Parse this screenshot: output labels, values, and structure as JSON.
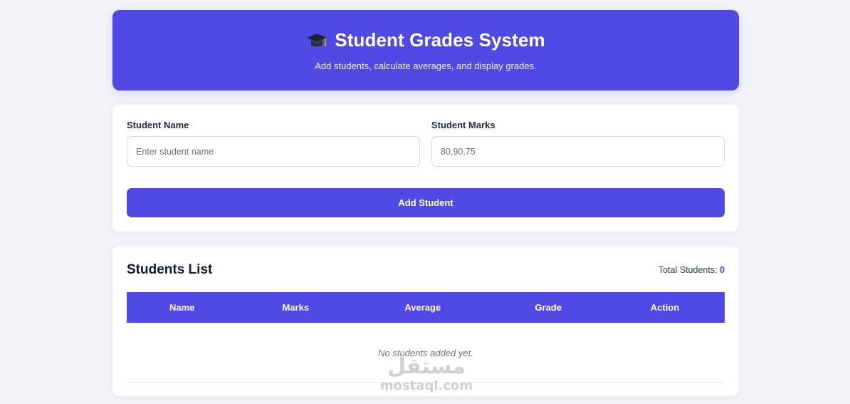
{
  "header": {
    "title": "Student Grades System",
    "subtitle": "Add students, calculate averages, and display grades.",
    "icon": "graduation-cap-icon"
  },
  "form": {
    "name_label": "Student Name",
    "name_placeholder": "Enter student name",
    "name_value": "",
    "marks_label": "Student Marks",
    "marks_placeholder": "80,90,75",
    "marks_value": "",
    "add_button": "Add Student"
  },
  "list": {
    "title": "Students List",
    "total_label": "Total Students:",
    "total_count": "0",
    "columns": [
      "Name",
      "Marks",
      "Average",
      "Grade",
      "Action"
    ],
    "empty_message": "No students added yet."
  },
  "watermark": {
    "arabic": "مستقل",
    "latin": "mostaql.com"
  },
  "colors": {
    "accent": "#5049e6",
    "background": "#f3f4f9"
  }
}
